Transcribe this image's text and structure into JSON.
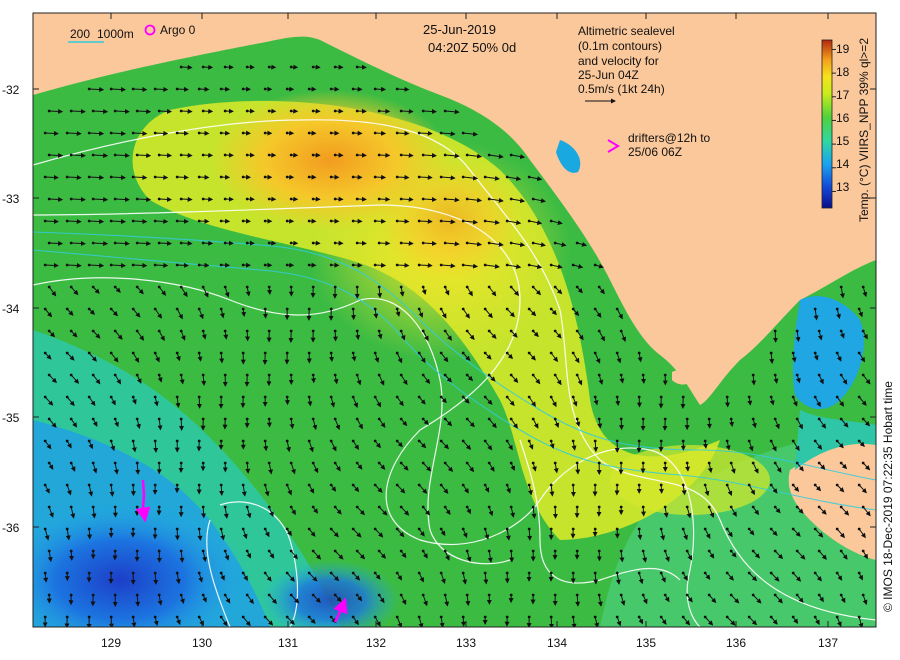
{
  "scale_bar": {
    "label_a": "200",
    "label_b": "1000m"
  },
  "argo": {
    "label": "Argo 0"
  },
  "header": {
    "date": "25-Jun-2019",
    "time_line": "04:20Z  50% 0d"
  },
  "altimetry_note": [
    "Altimetric sealevel",
    "(0.1m contours)",
    "and velocity for",
    "25-Jun 04Z",
    "0.5m/s (1kt 24h)"
  ],
  "drifters_note": [
    "drifters@12h to",
    "25/06 06Z"
  ],
  "colorbar": {
    "ticks": [
      "19",
      "18",
      "17",
      "16",
      "15",
      "14",
      "13"
    ],
    "min": 12.3,
    "max": 19.4,
    "label": "Temp. (°C) VIIRS_NPP 39% ql>=2"
  },
  "credit": "© IMOS 18-Dec-2019 07:22:35 Hobart time",
  "axes": {
    "lat_ticks": [
      "-32",
      "-33",
      "-34",
      "-35",
      "-36"
    ],
    "lon_ticks": [
      "129",
      "130",
      "131",
      "132",
      "133",
      "134",
      "135",
      "136",
      "137"
    ]
  },
  "colors": {
    "land": "#fbc89b",
    "drifter": "#ff00ff",
    "contour": "#ffffff",
    "isobath": "#33ccdd"
  }
}
